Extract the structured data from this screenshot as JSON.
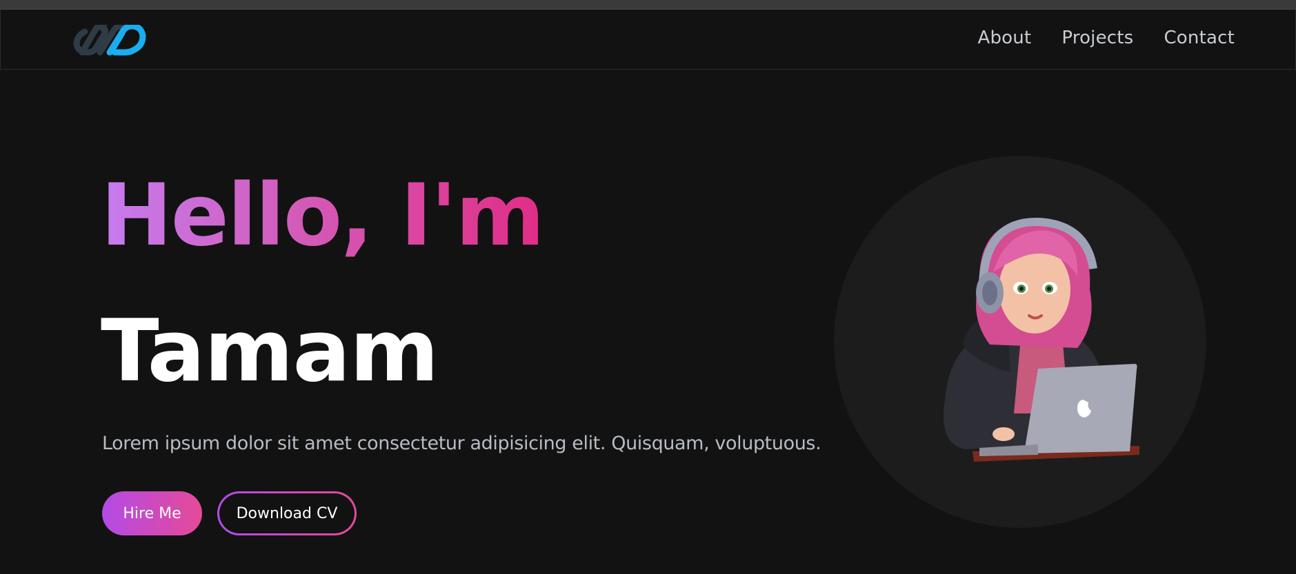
{
  "nav": {
    "links": [
      "About",
      "Projects",
      "Contact"
    ]
  },
  "hero": {
    "greeting": "Hello, I'm",
    "name": "Tamam",
    "description": "Lorem ipsum dolor sit amet consectetur adipisicing elit. Quisquam, voluptuous.",
    "hire_label": "Hire Me",
    "cv_label": "Download CV"
  },
  "icons": {
    "logo": "infinity-logo-icon",
    "avatar": "girl-with-laptop-avatar"
  },
  "colors": {
    "background": "#121212",
    "gradient_start": "#c67cf0",
    "gradient_end": "#e12d86",
    "logo_dark": "#2f3b47",
    "logo_light": "#18aef0"
  }
}
